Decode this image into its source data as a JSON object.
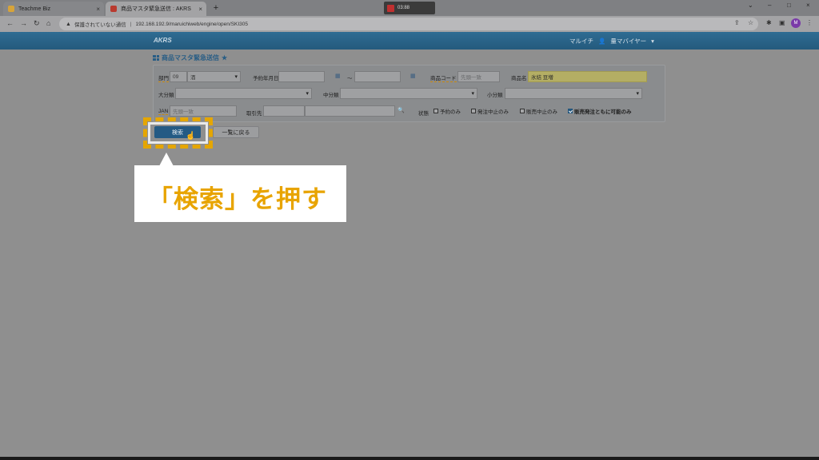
{
  "browser": {
    "tabs": [
      {
        "title": "Teachme Biz",
        "favicon_color": "#d7a43a"
      },
      {
        "title": "商品マスタ緊急送信 : AKRS",
        "favicon_color": "#b93a2f"
      }
    ],
    "new_tab": "+",
    "tab_close": "×",
    "recorder_time": "03:88",
    "window_controls": [
      "⌄",
      "–",
      "□",
      "×"
    ],
    "security_warning": "保護されていない通信",
    "url": "192.168.192.9/maruichiweb/engine/open/SKI305",
    "profile_initial": "M"
  },
  "app": {
    "logo": "AKRS",
    "user_company": "マルイチ",
    "user_name": "量マバイヤー"
  },
  "page": {
    "title": "商品マスタ緊急送信"
  },
  "form": {
    "department_label": "部門",
    "department_code": "09",
    "department_name": "酒",
    "reserve_date_label": "予約年月日",
    "date_separator": "～",
    "product_code_label": "商品コード",
    "product_code_placeholder": "先頭一致",
    "product_name_label": "商品名",
    "product_name_value": "氷結 豆増",
    "major_category_label": "大分類",
    "mid_category_label": "中分類",
    "minor_category_label": "小分類",
    "jan_label": "JAN",
    "jan_placeholder": "先頭一致",
    "supplier_label": "取引先",
    "status_label": "状態",
    "status_options": [
      {
        "label": "予約のみ",
        "checked": false
      },
      {
        "label": "発注中止のみ",
        "checked": false
      },
      {
        "label": "販売中止のみ",
        "checked": false
      },
      {
        "label": "販売発注ともに可能のみ",
        "checked": true
      }
    ]
  },
  "buttons": {
    "search": "検索",
    "back_to_list": "一覧に戻る"
  },
  "callout": {
    "text": "「検索」を押す"
  },
  "colors": {
    "highlight": "#e5a600",
    "header": "#2f6c93",
    "accent": "#285d85"
  }
}
